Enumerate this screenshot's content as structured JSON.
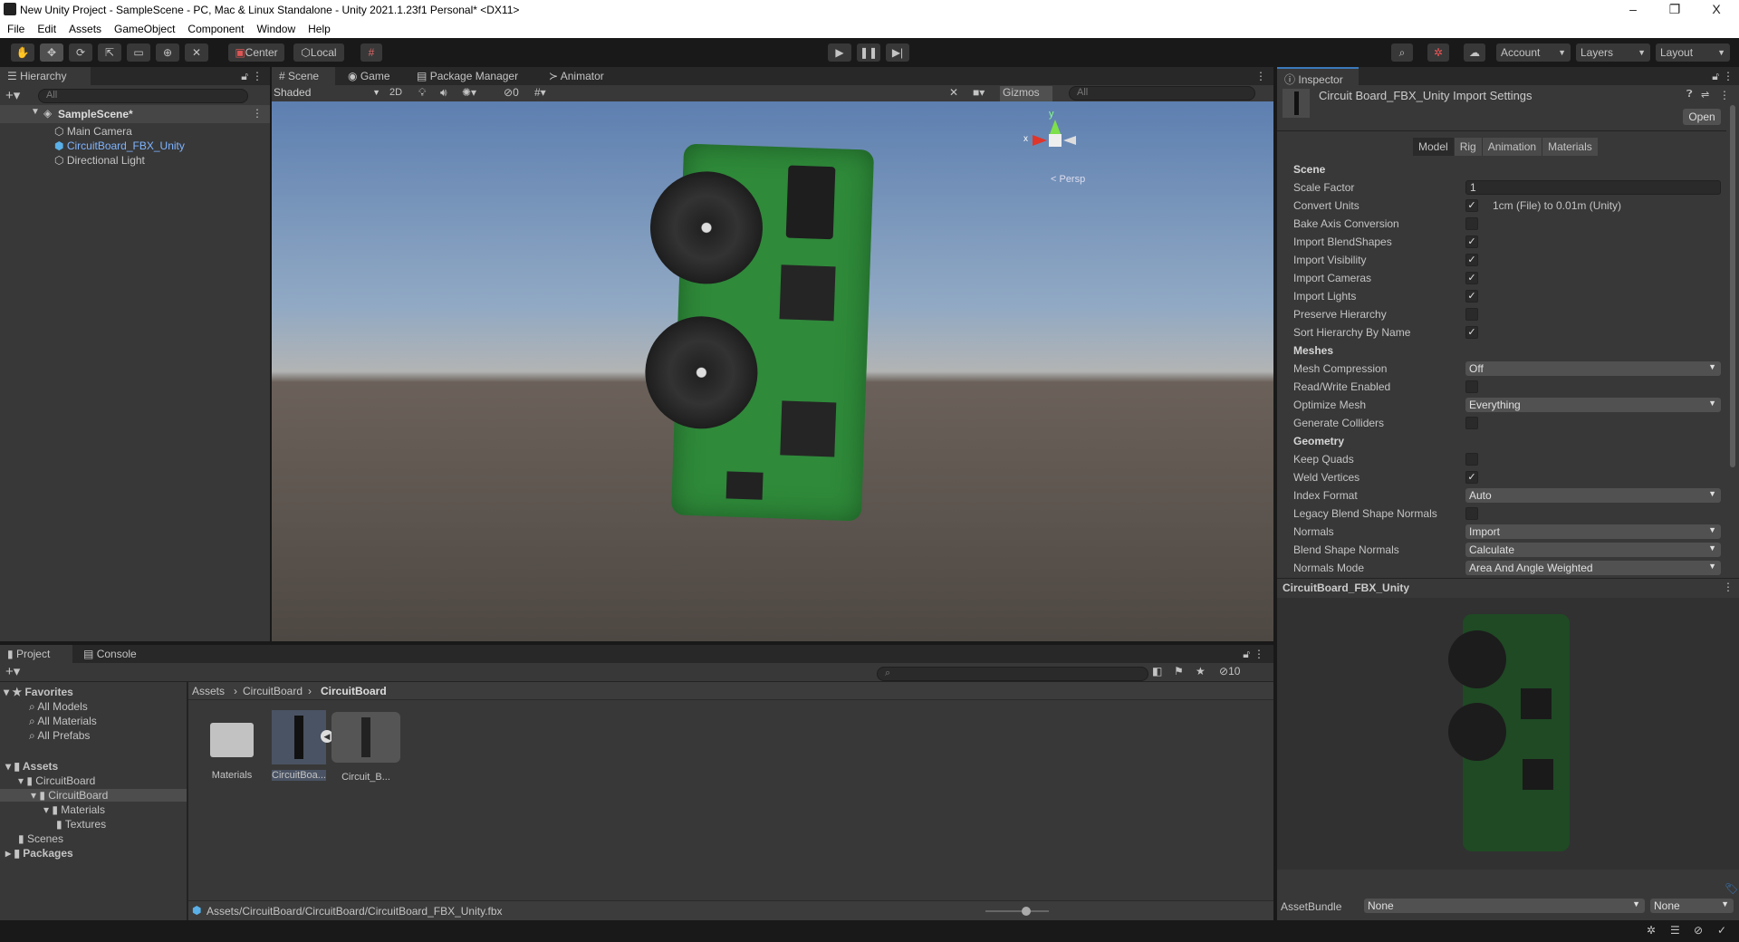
{
  "window": {
    "title": "New Unity Project - SampleScene - PC, Mac & Linux Standalone - Unity 2021.1.23f1 Personal* <DX11>",
    "minimize": "–",
    "maximize": "❐",
    "close": "X"
  },
  "menu": [
    "File",
    "Edit",
    "Assets",
    "GameObject",
    "Component",
    "Window",
    "Help"
  ],
  "toolbar": {
    "center": "Center",
    "local": "Local",
    "account": "Account",
    "layers": "Layers",
    "layout": "Layout"
  },
  "hierarchy": {
    "tab": "Hierarchy",
    "search_placeholder": "All",
    "scene": "SampleScene*",
    "items": [
      "Main Camera",
      "CircuitBoard_FBX_Unity",
      "Directional Light"
    ]
  },
  "scene": {
    "tabs": [
      "Scene",
      "Game",
      "Package Manager",
      "Animator"
    ],
    "shading": "Shaded",
    "mode2d": "2D",
    "hidden_count": "0",
    "gizmos": "Gizmos",
    "search_placeholder": "All",
    "persp": "< Persp",
    "axis_x": "x",
    "axis_y": "y"
  },
  "inspector": {
    "tab": "Inspector",
    "title": "Circuit Board_FBX_Unity Import Settings",
    "open": "Open",
    "tabs": [
      "Model",
      "Rig",
      "Animation",
      "Materials"
    ],
    "active_tab": "Model",
    "sections": [
      {
        "header": "Scene",
        "rows": [
          {
            "label": "Scale Factor",
            "type": "field",
            "value": "1"
          },
          {
            "label": "Convert Units",
            "type": "check",
            "checked": true,
            "note": "1cm (File) to 0.01m (Unity)"
          },
          {
            "label": "Bake Axis Conversion",
            "type": "check",
            "checked": false
          },
          {
            "label": "Import BlendShapes",
            "type": "check",
            "checked": true
          },
          {
            "label": "Import Visibility",
            "type": "check",
            "checked": true
          },
          {
            "label": "Import Cameras",
            "type": "check",
            "checked": true
          },
          {
            "label": "Import Lights",
            "type": "check",
            "checked": true
          },
          {
            "label": "Preserve Hierarchy",
            "type": "check",
            "checked": false
          },
          {
            "label": "Sort Hierarchy By Name",
            "type": "check",
            "checked": true
          }
        ]
      },
      {
        "header": "Meshes",
        "rows": [
          {
            "label": "Mesh Compression",
            "type": "dropdown",
            "value": "Off"
          },
          {
            "label": "Read/Write Enabled",
            "type": "check",
            "checked": false
          },
          {
            "label": "Optimize Mesh",
            "type": "dropdown",
            "value": "Everything"
          },
          {
            "label": "Generate Colliders",
            "type": "check",
            "checked": false
          }
        ]
      },
      {
        "header": "Geometry",
        "rows": [
          {
            "label": "Keep Quads",
            "type": "check",
            "checked": false
          },
          {
            "label": "Weld Vertices",
            "type": "check",
            "checked": true
          },
          {
            "label": "Index Format",
            "type": "dropdown",
            "value": "Auto"
          },
          {
            "label": "Legacy Blend Shape Normals",
            "type": "check",
            "checked": false
          },
          {
            "label": "Normals",
            "type": "dropdown",
            "value": "Import"
          },
          {
            "label": "Blend Shape Normals",
            "type": "dropdown",
            "value": "Calculate"
          },
          {
            "label": "Normals Mode",
            "type": "dropdown",
            "value": "Area And Angle Weighted"
          }
        ]
      }
    ],
    "preview_title": "CircuitBoard_FBX_Unity",
    "assetbundle_label": "AssetBundle",
    "assetbundle_value": "None",
    "assetbundle_variant": "None"
  },
  "project": {
    "tabs": [
      "Project",
      "Console"
    ],
    "hidden_count": "10",
    "favorites": "Favorites",
    "fav_items": [
      "All Models",
      "All Materials",
      "All Prefabs"
    ],
    "tree": [
      {
        "label": "Assets",
        "depth": 0,
        "bold": true
      },
      {
        "label": "CircuitBoard",
        "depth": 1
      },
      {
        "label": "CircuitBoard",
        "depth": 2,
        "selected": true
      },
      {
        "label": "Materials",
        "depth": 3
      },
      {
        "label": "Textures",
        "depth": 4
      },
      {
        "label": "Scenes",
        "depth": 1
      },
      {
        "label": "Packages",
        "depth": 0,
        "bold": true
      }
    ],
    "breadcrumb": [
      "Assets",
      "CircuitBoard",
      "CircuitBoard"
    ],
    "assets": [
      "Materials",
      "CircuitBoa...",
      "Circuit_B..."
    ],
    "path": "Assets/CircuitBoard/CircuitBoard/CircuitBoard_FBX_Unity.fbx"
  },
  "colors": {
    "accent": "#3a79bb",
    "panel": "#383838",
    "selected_text": "#7fb4ff"
  }
}
